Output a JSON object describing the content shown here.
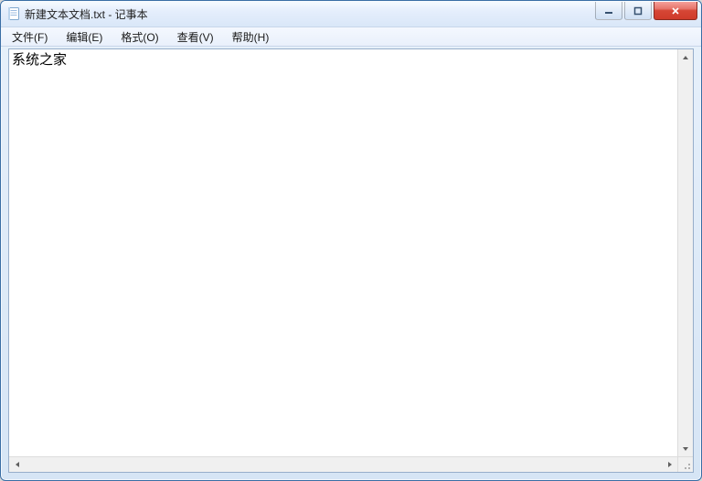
{
  "window": {
    "title": "新建文本文档.txt - 记事本"
  },
  "menu": {
    "file": "文件(F)",
    "edit": "编辑(E)",
    "format": "格式(O)",
    "view": "查看(V)",
    "help": "帮助(H)"
  },
  "editor": {
    "content": "系统之家"
  }
}
